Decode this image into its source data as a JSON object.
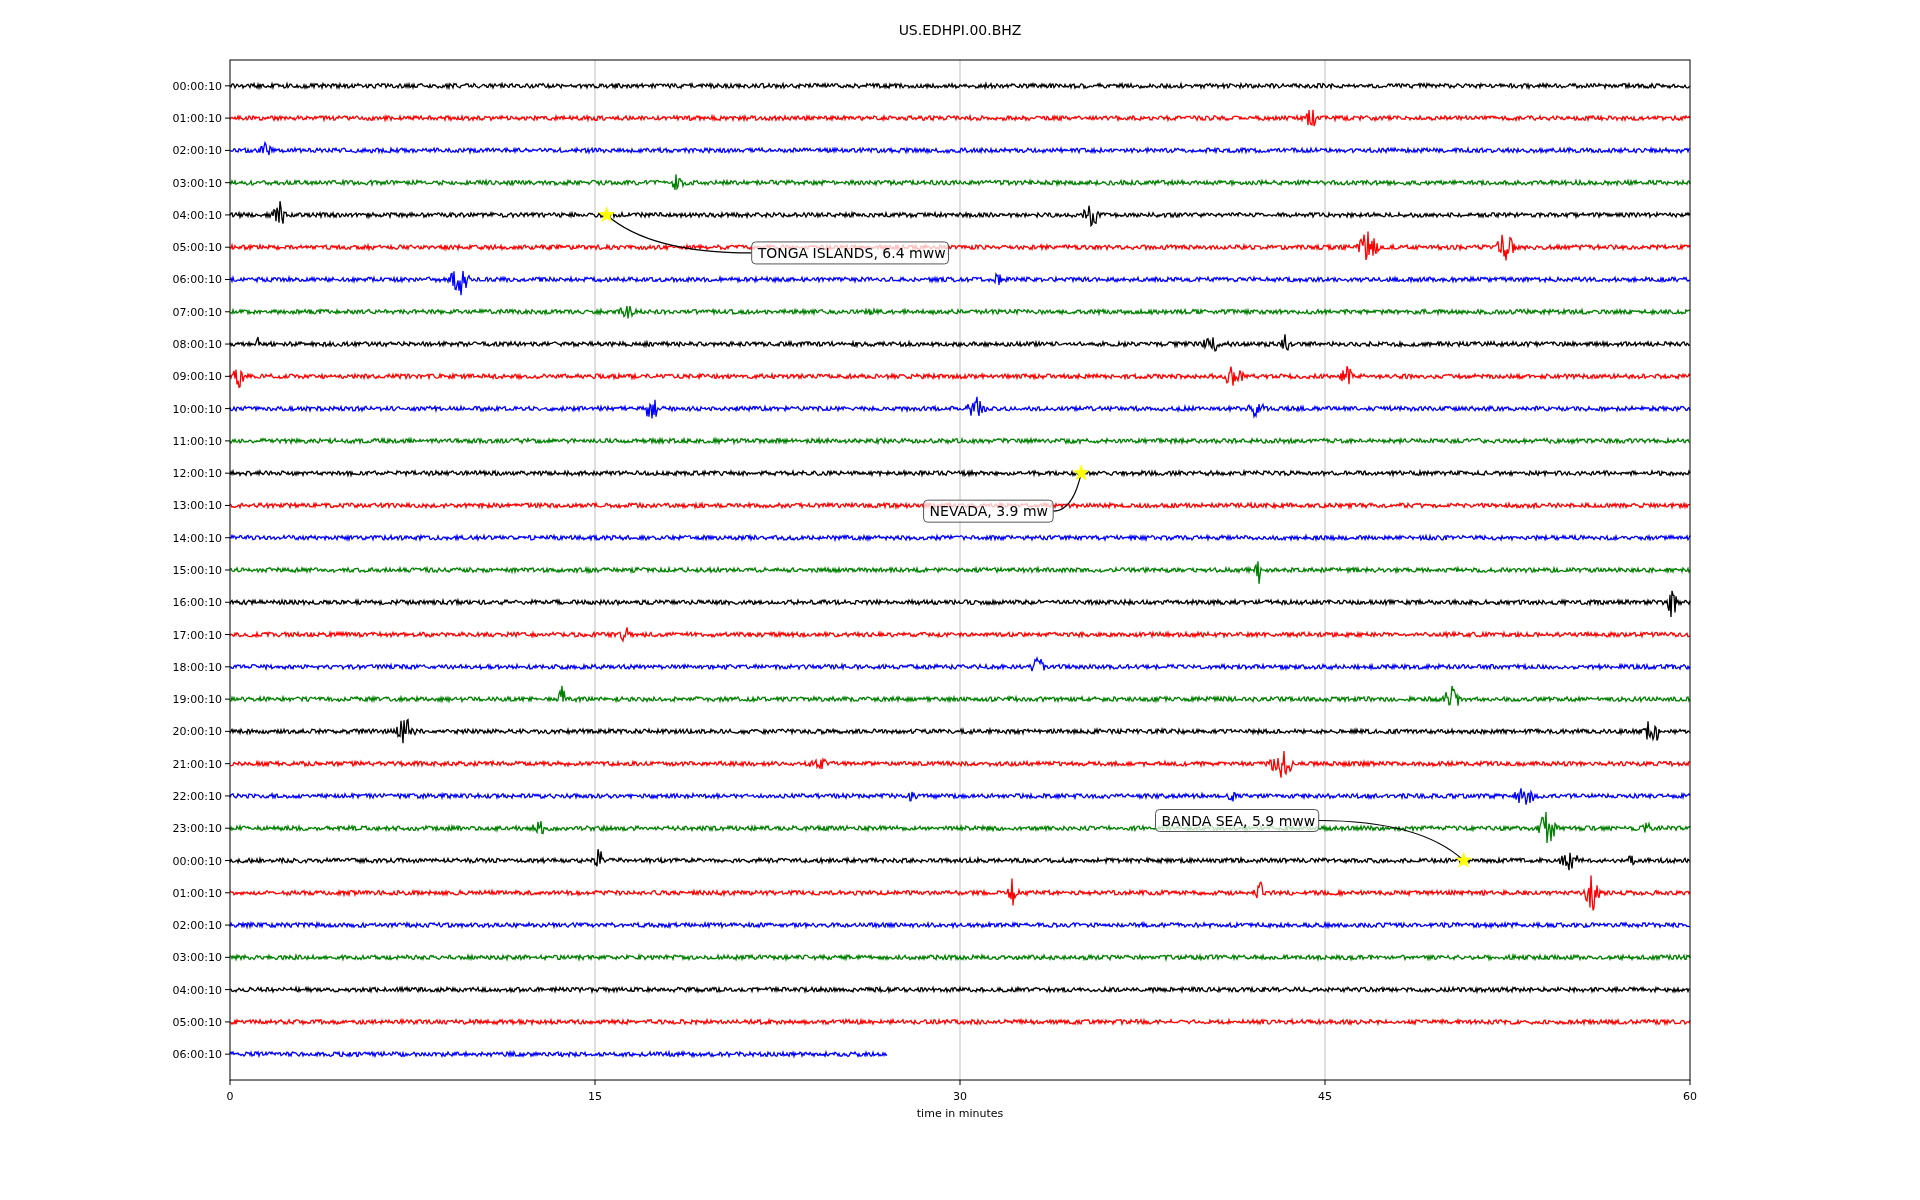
{
  "plot": {
    "title": "US.EDHPI.00.BHZ",
    "rows": [
      {
        "label": "00:00:10",
        "color": "#000000",
        "kind": "full"
      },
      {
        "label": "01:00:10",
        "color": "#ff0000",
        "kind": "full"
      },
      {
        "label": "02:00:10",
        "color": "#0000ff",
        "kind": "full"
      },
      {
        "label": "03:00:10",
        "color": "#008000",
        "kind": "full"
      },
      {
        "label": "04:00:10",
        "color": "#000000",
        "kind": "full",
        "event": "TONGA ISLANDS, 6.4 mww"
      },
      {
        "label": "05:00:10",
        "color": "#ff0000",
        "kind": "full"
      },
      {
        "label": "06:00:10",
        "color": "#0000ff",
        "kind": "full"
      },
      {
        "label": "07:00:10",
        "color": "#008000",
        "kind": "full"
      },
      {
        "label": "08:00:10",
        "color": "#000000",
        "kind": "full"
      },
      {
        "label": "09:00:10",
        "color": "#ff0000",
        "kind": "full"
      },
      {
        "label": "10:00:10",
        "color": "#0000ff",
        "kind": "full"
      },
      {
        "label": "11:00:10",
        "color": "#008000",
        "kind": "full"
      },
      {
        "label": "12:00:10",
        "color": "#000000",
        "kind": "full",
        "event": "NEVADA, 3.9 mw"
      },
      {
        "label": "13:00:10",
        "color": "#ff0000",
        "kind": "full"
      },
      {
        "label": "14:00:10",
        "color": "#0000ff",
        "kind": "full"
      },
      {
        "label": "15:00:10",
        "color": "#008000",
        "kind": "full"
      },
      {
        "label": "16:00:10",
        "color": "#000000",
        "kind": "full"
      },
      {
        "label": "17:00:10",
        "color": "#ff0000",
        "kind": "full"
      },
      {
        "label": "18:00:10",
        "color": "#0000ff",
        "kind": "full"
      },
      {
        "label": "19:00:10",
        "color": "#008000",
        "kind": "full"
      },
      {
        "label": "20:00:10",
        "color": "#000000",
        "kind": "full"
      },
      {
        "label": "21:00:10",
        "color": "#ff0000",
        "kind": "full"
      },
      {
        "label": "22:00:10",
        "color": "#0000ff",
        "kind": "full"
      },
      {
        "label": "23:00:10",
        "color": "#008000",
        "kind": "full"
      },
      {
        "label": "00:00:10",
        "color": "#000000",
        "kind": "full",
        "event": "BANDA SEA, 5.9 mww"
      },
      {
        "label": "01:00:10",
        "color": "#ff0000",
        "kind": "full"
      },
      {
        "label": "02:00:10",
        "color": "#0000ff",
        "kind": "full"
      },
      {
        "label": "03:00:10",
        "color": "#008000",
        "kind": "full"
      },
      {
        "label": "04:00:10",
        "color": "#000000",
        "kind": "full"
      },
      {
        "label": "05:00:10",
        "color": "#ff0000",
        "kind": "full"
      },
      {
        "label": "06:00:10",
        "color": "#0000ff",
        "kind": "partial"
      }
    ],
    "x_axis": {
      "label": "time in minutes",
      "ticks": [
        "0",
        "15",
        "30",
        "45",
        "60"
      ]
    }
  }
}
